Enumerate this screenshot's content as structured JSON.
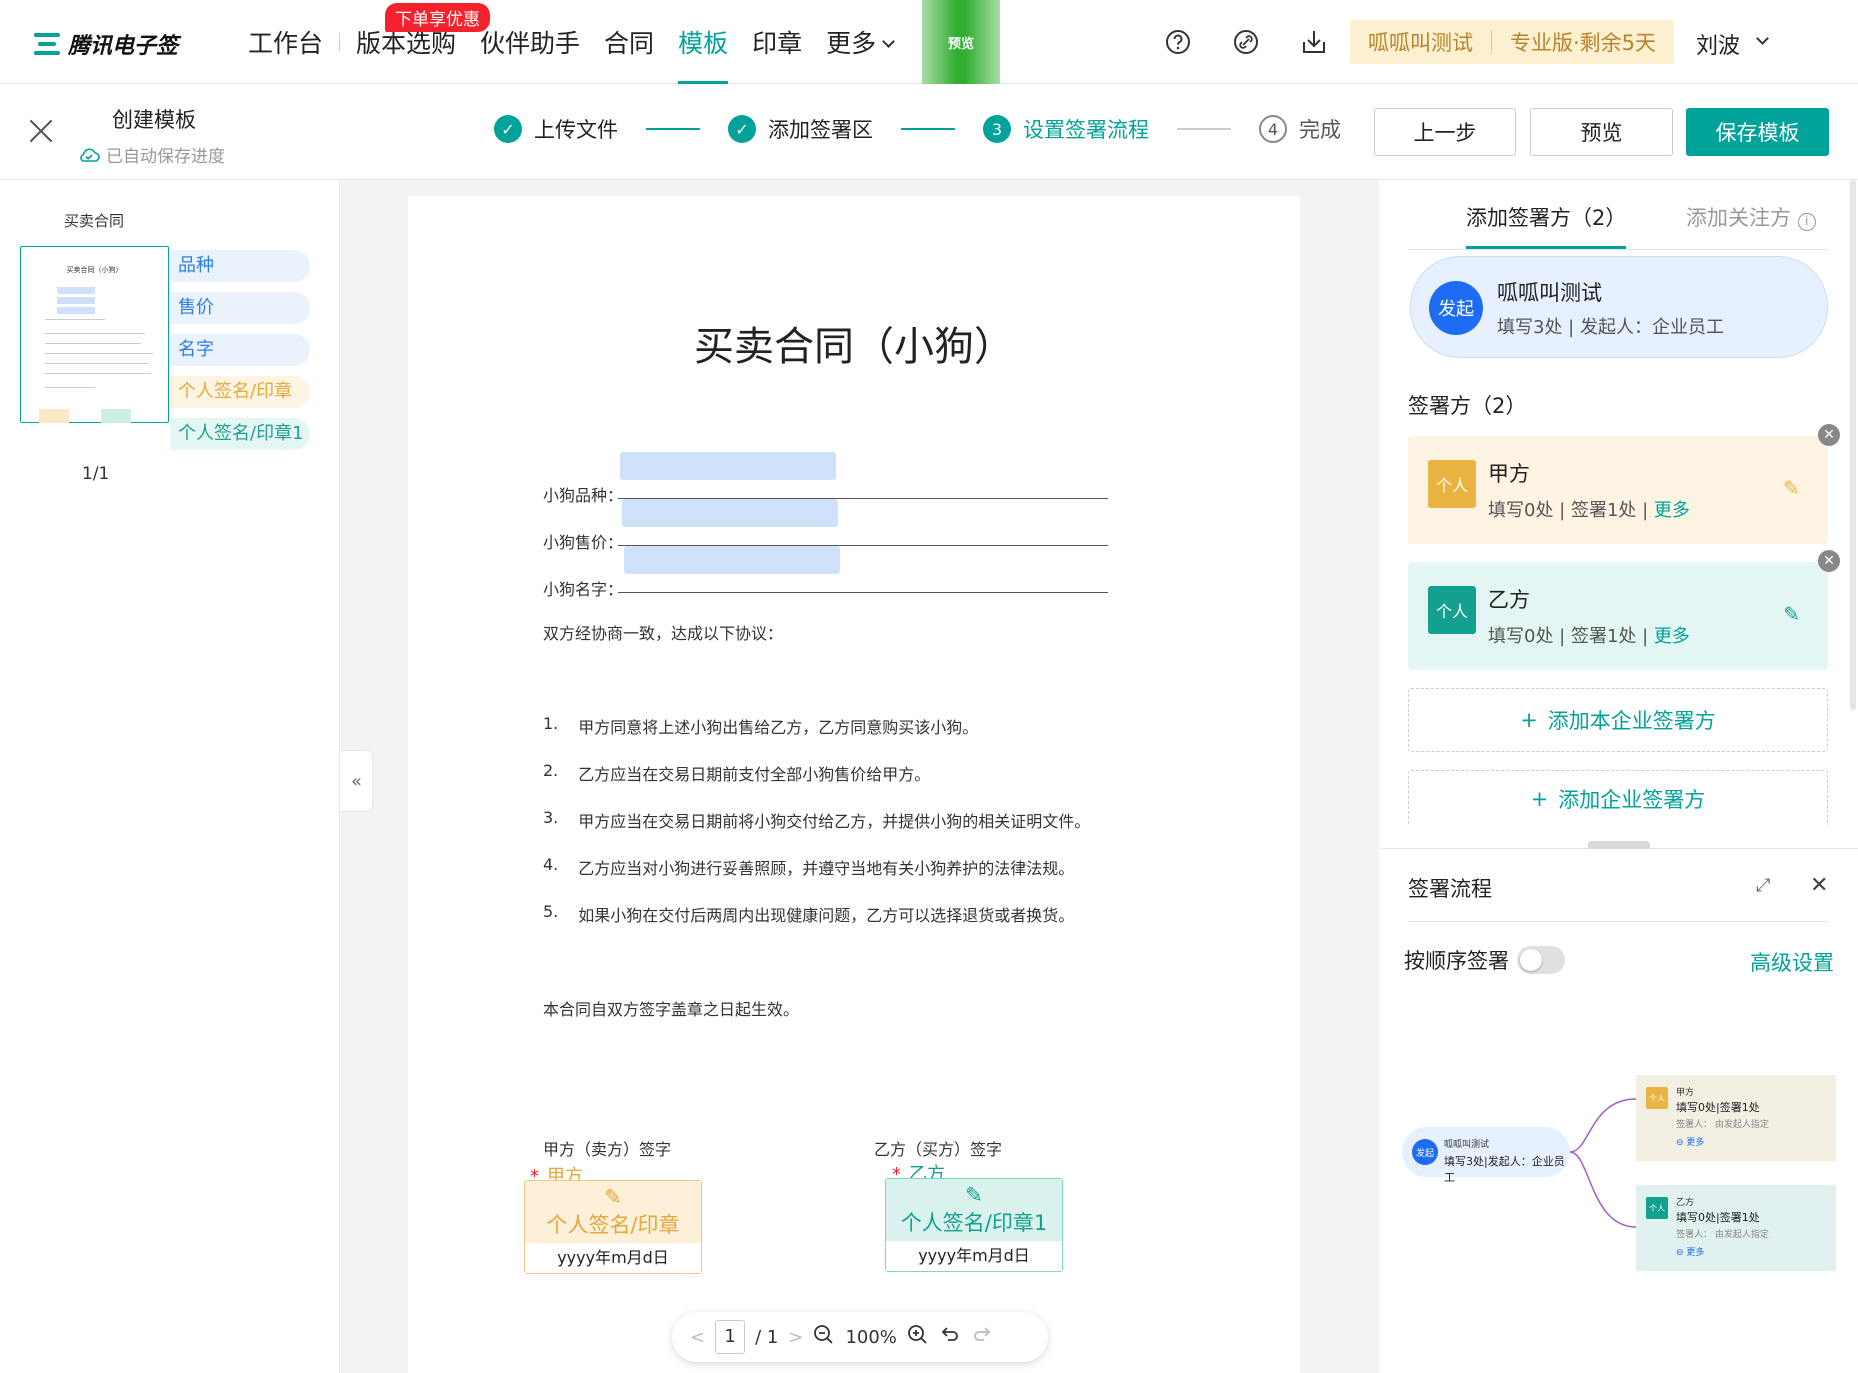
{
  "topnav": {
    "logo_text": "腾讯电子签",
    "items": [
      "工作台",
      "版本选购",
      "伙伴助手",
      "合同",
      "模板",
      "印章",
      "更多"
    ],
    "active": "模板",
    "promo_badge": "下单享优惠",
    "preview_tag": "预览",
    "account_name": "呱呱叫测试",
    "account_plan": "专业版·剩余5天",
    "user_name": "刘波"
  },
  "subheader": {
    "title": "创建模板",
    "autosave": "已自动保存进度",
    "steps": [
      {
        "num": "",
        "label": "上传文件",
        "state": "done"
      },
      {
        "num": "",
        "label": "添加签署区",
        "state": "done"
      },
      {
        "num": "3",
        "label": "设置签署流程",
        "state": "current"
      },
      {
        "num": "4",
        "label": "完成",
        "state": "todo"
      }
    ],
    "btn_prev": "上一步",
    "btn_preview": "预览",
    "btn_save": "保存模板"
  },
  "leftpanel": {
    "doc_name": "买卖合同",
    "thumb_title": "买卖合同（小狗）",
    "tags": [
      "品种",
      "售价",
      "名字",
      "个人签名/印章",
      "个人签名/印章1"
    ],
    "page_indicator": "1/1"
  },
  "document": {
    "title": "买卖合同（小狗）",
    "fields": [
      "小狗品种：",
      "小狗售价：",
      "小狗名字："
    ],
    "intro": "双方经协商一致，达成以下协议：",
    "clauses": [
      {
        "n": "1.",
        "text": "甲方同意将上述小狗出售给乙方，乙方同意购买该小狗。"
      },
      {
        "n": "2.",
        "text": "乙方应当在交易日期前支付全部小狗售价给甲方。"
      },
      {
        "n": "3.",
        "text": "甲方应当在交易日期前将小狗交付给乙方，并提供小狗的相关证明文件。"
      },
      {
        "n": "4.",
        "text": "乙方应当对小狗进行妥善照顾，并遵守当地有关小狗养护的法律法规。"
      },
      {
        "n": "5.",
        "text": "如果小狗在交付后两周内出现健康问题，乙方可以选择退货或者换货。"
      }
    ],
    "effective": "本合同自双方签字盖章之日起生效。",
    "sig_a_label": "甲方（卖方）签字",
    "sig_b_label": "乙方（买方）签字",
    "sig_a_party": "甲方",
    "sig_b_party": "乙方",
    "sig_a_box": "个人签名/印章",
    "sig_b_box": "个人签名/印章1",
    "date_format": "yyyy年m月d日"
  },
  "pager": {
    "current": "1",
    "total": "/ 1",
    "zoom": "100%"
  },
  "rightpanel": {
    "tab_active": "添加签署方（2）",
    "tab_other": "添加关注方",
    "initiator": {
      "badge": "发起",
      "name": "呱呱叫测试",
      "sub": "填写3处 | 发起人：企业员工"
    },
    "signers_heading": "签署方（2）",
    "signers": [
      {
        "avatar": "个人",
        "name": "甲方",
        "sub": "填写0处 | 签署1处 | ",
        "more": "更多"
      },
      {
        "avatar": "个人",
        "name": "乙方",
        "sub": "填写0处 | 签署1处 | ",
        "more": "更多"
      }
    ],
    "add_own": "添加本企业签署方",
    "add_ent": "添加企业签署方",
    "flow": {
      "title": "签署流程",
      "sequential": "按顺序签署",
      "advanced": "高级设置",
      "initiator_badge": "发起",
      "initiator_name": "呱呱叫测试",
      "initiator_sub": "填写3处|发起人：企业员工",
      "cards": [
        {
          "avatar": "个人",
          "name": "甲方",
          "sub": "填写0处|签署1处",
          "signer": "签署人：  由发起人指定",
          "more": "更多"
        },
        {
          "avatar": "个人",
          "name": "乙方",
          "sub": "填写0处|签署1处",
          "signer": "签署人：  由发起人指定",
          "more": "更多"
        }
      ]
    }
  },
  "colors": {
    "primary": "#00a29a",
    "blue": "#1d6cf2",
    "yellow": "#eab442",
    "promo": "#f5222d"
  }
}
